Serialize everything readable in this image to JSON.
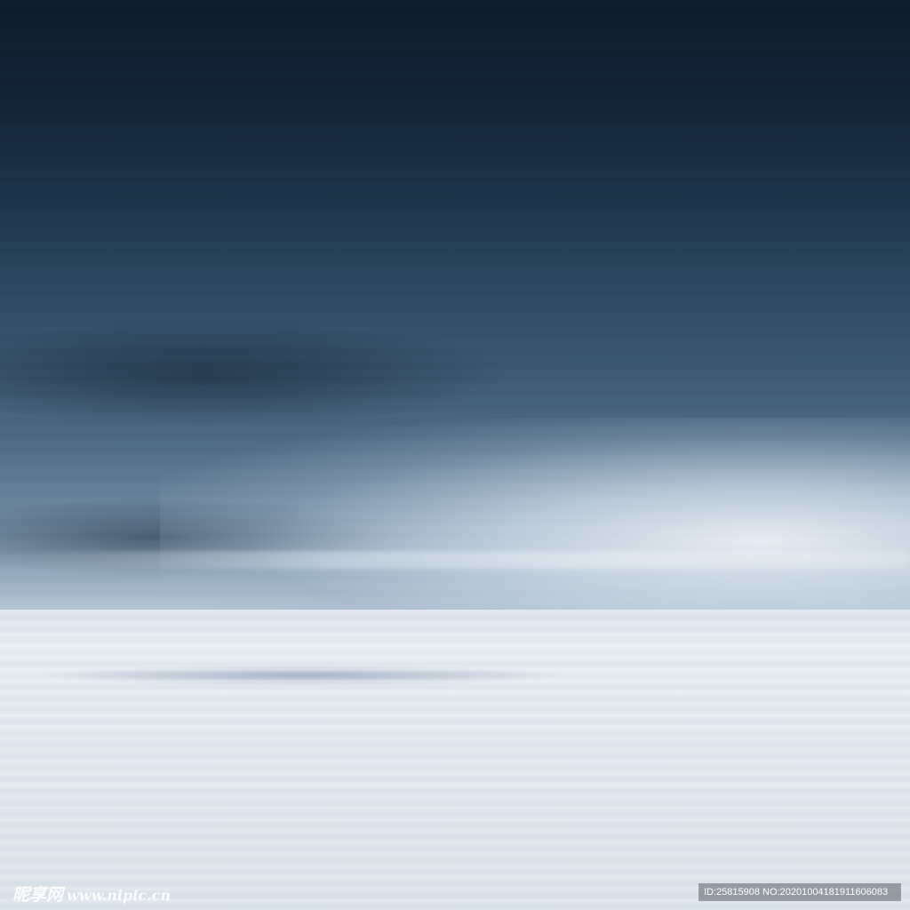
{
  "watermark": {
    "logo_name": "昵享网",
    "logo_url": "www.nipic.cn",
    "id_text": "ID:25815908 NO:20201004181911606083"
  },
  "colors": {
    "sky_top": "#0f1b29",
    "sky_mid": "#3b5872",
    "horizon_glow": "#e6ecf3",
    "ground": "#e2e9f0"
  }
}
